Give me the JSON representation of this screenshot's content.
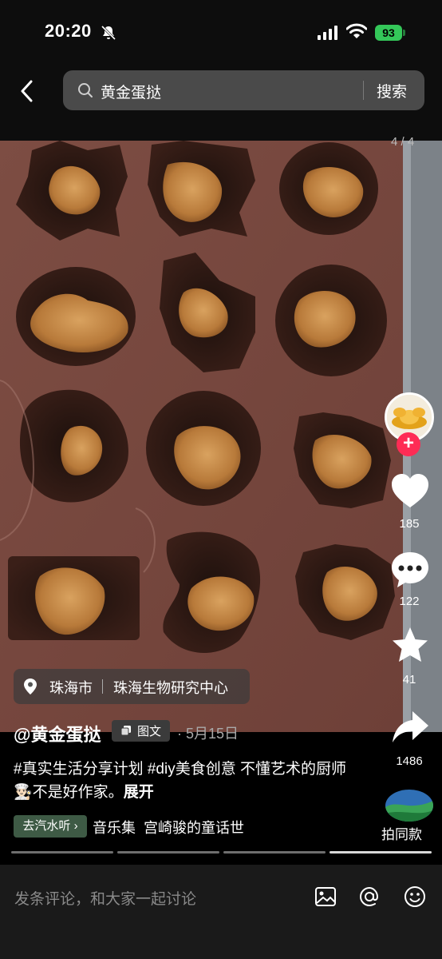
{
  "status": {
    "time": "20:20",
    "battery": "93"
  },
  "search": {
    "query": "黄金蛋挞",
    "button": "搜索"
  },
  "photo": {
    "page_indicator": "4 / 4"
  },
  "actions": {
    "likes": "185",
    "comments": "122",
    "favorites": "41",
    "shares": "1486"
  },
  "location": {
    "city": "珠海市",
    "place": "珠海生物研究中心"
  },
  "post": {
    "author": "@黄金蛋挞",
    "type": "图文",
    "date": "· 5月15日",
    "caption_main": "#真实生活分享计划 #diy美食创意 不懂艺术的厨师",
    "caption_emoji": "👨🏻‍🍳",
    "caption_rest": "不是好作家。",
    "caption_expand": "展开"
  },
  "music": {
    "badge": "去汽水听 ›",
    "title": "音乐集  宫崎骏的童话世"
  },
  "same_style": {
    "label": "拍同款"
  },
  "comment_bar": {
    "placeholder": "发条评论，和大家一起讨论"
  },
  "colors": {
    "accent": "#fe2c55",
    "battery": "#34c759",
    "mold": "#7a4a40"
  }
}
